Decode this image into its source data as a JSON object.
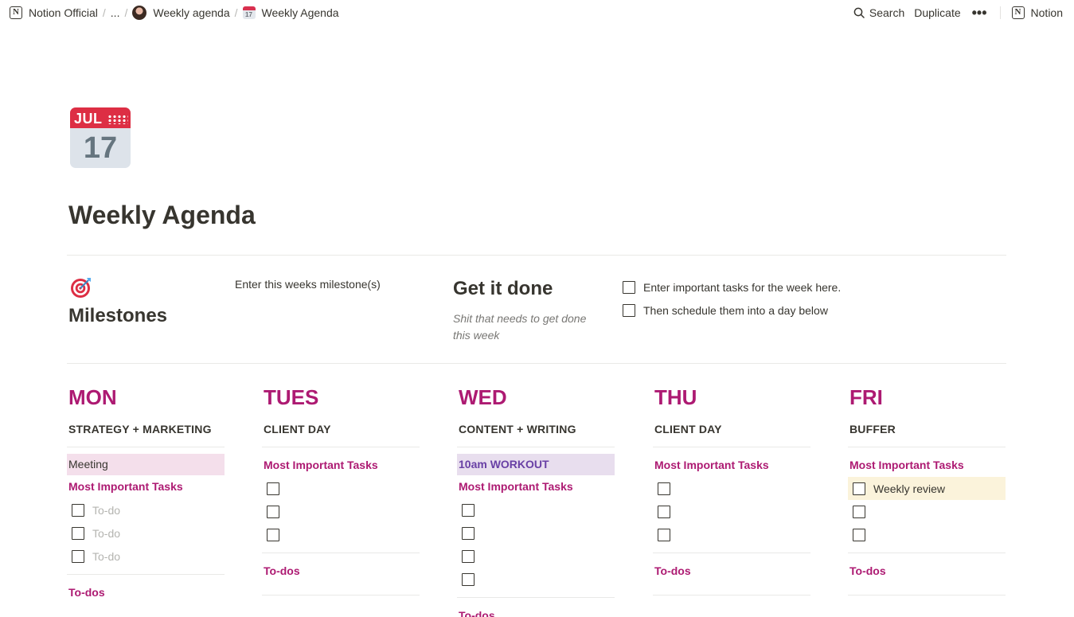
{
  "breadcrumb": {
    "workspace": "Notion Official",
    "ellipsis": "...",
    "parent": "Weekly agenda",
    "current": "Weekly Agenda",
    "separator": "/"
  },
  "topbar": {
    "search_label": "Search",
    "duplicate_label": "Duplicate",
    "more_label": "•••",
    "notion_label": "Notion"
  },
  "page": {
    "icon": "calendar-icon",
    "icon_month": "JUL",
    "icon_day": "17",
    "title": "Weekly Agenda"
  },
  "milestones": {
    "icon": "target-icon",
    "title": "Milestones",
    "text": "Enter this weeks milestone(s)"
  },
  "get_it_done": {
    "title": "Get it done",
    "subtitle": "Shit that needs to get done this week",
    "tasks": [
      "Enter important tasks for the week here.",
      "Then schedule them into a day below"
    ]
  },
  "colors": {
    "accent": "#ad1a72",
    "text": "#37352f",
    "pink_bg": "#f4dfeb",
    "purple_bg": "#e8deee",
    "purple_text": "#6940a5",
    "yellow_bg": "#fbf3db"
  },
  "days": [
    {
      "name": "MON",
      "theme": "STRATEGY + MARKETING",
      "block": {
        "label": "Meeting",
        "style": "pink"
      },
      "mit_label": "Most Important Tasks",
      "todos": [
        "To-do",
        "To-do",
        "To-do"
      ],
      "todos_placeholder": true,
      "todos_label": "To-dos"
    },
    {
      "name": "TUES",
      "theme": "CLIENT DAY",
      "block": null,
      "mit_label": "Most Important Tasks",
      "todos": [
        "",
        "",
        ""
      ],
      "todos_label": "To-dos"
    },
    {
      "name": "WED",
      "theme": "CONTENT + WRITING",
      "block": {
        "label": "10am WORKOUT",
        "style": "purple"
      },
      "mit_label": "Most Important Tasks",
      "todos": [
        "",
        "",
        "",
        ""
      ],
      "todos_label": "To-dos"
    },
    {
      "name": "THU",
      "theme": "CLIENT DAY",
      "block": null,
      "mit_label": "Most Important Tasks",
      "todos": [
        "",
        "",
        ""
      ],
      "todos_label": "To-dos"
    },
    {
      "name": "FRI",
      "theme": "BUFFER",
      "block": null,
      "mit_label": "Most Important Tasks",
      "todos": [
        "Weekly review",
        "",
        ""
      ],
      "highlight_first": true,
      "todos_label": "To-dos"
    }
  ]
}
